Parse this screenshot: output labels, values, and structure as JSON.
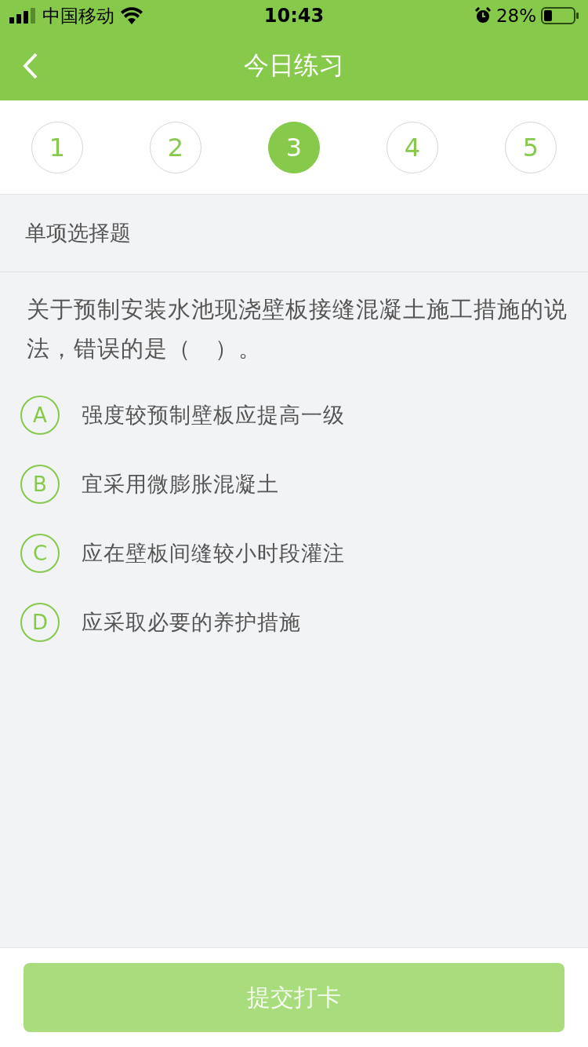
{
  "status_bar": {
    "carrier": "中国移动",
    "time": "10:43",
    "battery": "28%"
  },
  "nav_bar": {
    "title": "今日练习"
  },
  "question_tabs": [
    {
      "label": "1",
      "selected": false
    },
    {
      "label": "2",
      "selected": false
    },
    {
      "label": "3",
      "selected": true
    },
    {
      "label": "4",
      "selected": false
    },
    {
      "label": "5",
      "selected": false
    }
  ],
  "question": {
    "type_label": "单项选择题",
    "text": "关于预制安装水池现浇壁板接缝混凝土施工措施的说法，错误的是（　）。",
    "options": [
      {
        "letter": "A",
        "text": "强度较预制壁板应提高一级",
        "selected": false
      },
      {
        "letter": "B",
        "text": "宜采用微膨胀混凝土",
        "selected": false
      },
      {
        "letter": "C",
        "text": "应在壁板间缝较小时段灌注",
        "selected": false
      },
      {
        "letter": "D",
        "text": "应采取必要的养护措施",
        "selected": false
      }
    ]
  },
  "submit_button": {
    "label": "提交打卡",
    "disabled": true
  }
}
